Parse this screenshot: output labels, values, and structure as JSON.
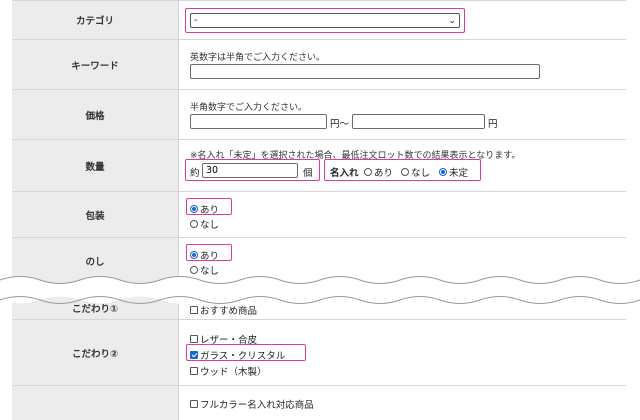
{
  "category": {
    "label": "カテゴリ",
    "selected": "-"
  },
  "keyword": {
    "label": "キーワード",
    "hint": "英数字は半角でご入力ください。",
    "value": ""
  },
  "price": {
    "label": "価格",
    "hint": "半角数字でご入力ください。",
    "from_value": "",
    "from_unit": "円～",
    "to_value": "",
    "to_unit": "円"
  },
  "quantity": {
    "label": "数量",
    "note": "※名入れ「未定」を選択された場合、最低注文ロット数での結果表示となります。",
    "prefix": "約",
    "value": "30",
    "unit": "個",
    "naire_label": "名入れ",
    "options": [
      {
        "label": "あり"
      },
      {
        "label": "なし"
      },
      {
        "label": "未定"
      }
    ]
  },
  "wrapping": {
    "label": "包装",
    "options": [
      {
        "label": "あり"
      },
      {
        "label": "なし"
      }
    ]
  },
  "noshi": {
    "label": "のし",
    "options": [
      {
        "label": "あり"
      },
      {
        "label": "なし"
      }
    ]
  },
  "kodawari1": {
    "label": "こだわり①",
    "option": "おすすめ商品"
  },
  "kodawari2": {
    "label": "こだわり②",
    "options": [
      {
        "label": "レザー・合皮"
      },
      {
        "label": "ガラス・クリスタル"
      },
      {
        "label": "ウッド（木製）"
      }
    ]
  },
  "kodawari3": {
    "option": "フルカラー名入れ対応商品"
  },
  "colors": {
    "highlight": "#e23a9a",
    "label_bg": "#ececec",
    "accent": "#1a66d2"
  }
}
